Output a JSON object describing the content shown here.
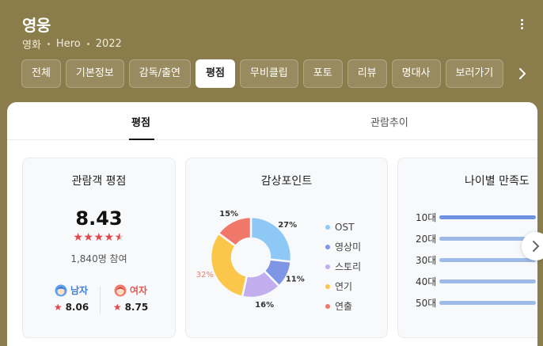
{
  "header": {
    "title": "영웅",
    "meta": [
      "영화",
      "Hero",
      "2022"
    ],
    "tabs": [
      "전체",
      "기본정보",
      "감독/출연",
      "평점",
      "무비클립",
      "포토",
      "리뷰",
      "명대사",
      "보러가기"
    ],
    "active_tab": "평점"
  },
  "subtabs": [
    "평점",
    "관람추이"
  ],
  "rating_card": {
    "title": "관람객 평점",
    "score": "8.43",
    "stars": 4.5,
    "participants": "1,840명 참여",
    "male_label": "남자",
    "male_score": "8.06",
    "female_label": "여자",
    "female_score": "8.75"
  },
  "appeal_card": {
    "title": "감상포인트",
    "chart_data": {
      "type": "pie",
      "categories": [
        "OST",
        "영상미",
        "스토리",
        "연기",
        "연출"
      ],
      "values": [
        27,
        11,
        16,
        32,
        15
      ],
      "labels": [
        "27%",
        "11%",
        "16%",
        "32%",
        "15%"
      ],
      "colors": [
        "#8ec8f5",
        "#7f96e4",
        "#c2adef",
        "#fbc74a",
        "#f0786a"
      ]
    }
  },
  "age_card": {
    "title": "나이별 만족도",
    "chart_data": {
      "type": "bar",
      "categories": [
        "10대",
        "20대",
        "30대",
        "40대",
        "50대"
      ],
      "colors": [
        "#6f93e0",
        "#9dbbe6",
        "#9dbbe6",
        "#9dbbe6",
        "#9dbbe6"
      ]
    }
  },
  "colors": {
    "header_bg": "#8b7c4b",
    "star": "#e0474c",
    "male": "#3f7fd8",
    "female": "#e25852"
  }
}
